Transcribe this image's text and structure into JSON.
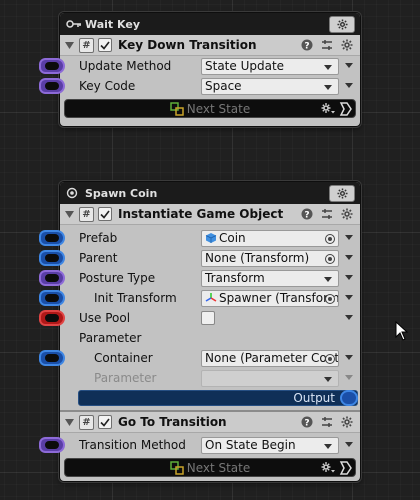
{
  "node1": {
    "title": "Wait Key",
    "component": {
      "title": "Key Down Transition",
      "rows": [
        {
          "label": "Update Method",
          "value": "State Update"
        },
        {
          "label": "Key Code",
          "value": "Space"
        }
      ],
      "state_bar": "Next State"
    }
  },
  "node2": {
    "title": "Spawn Coin",
    "component1": {
      "title": "Instantiate Game Object",
      "rows": {
        "prefab": {
          "label": "Prefab",
          "value": "Coin"
        },
        "parent": {
          "label": "Parent",
          "value": "None (Transform)"
        },
        "posture_type": {
          "label": "Posture Type",
          "value": "Transform"
        },
        "init_transform": {
          "label": "Init Transform",
          "value": "Spawner (Transform)"
        },
        "use_pool": {
          "label": "Use Pool",
          "checked": false
        },
        "parameter_header": {
          "label": "Parameter"
        },
        "container": {
          "label": "Container",
          "value": "None (Parameter Container)"
        },
        "parameter": {
          "label": "Parameter",
          "value": ""
        }
      },
      "output_label": "Output"
    },
    "component2": {
      "title": "Go To Transition",
      "rows": [
        {
          "label": "Transition Method",
          "value": "On State Begin"
        }
      ],
      "state_bar": "Next State"
    }
  },
  "colors": {
    "port_purple": "#5a3ea6",
    "port_blue": "#1a4fa8",
    "port_red": "#b01818",
    "output_bar": "#0f2f57",
    "node_body": "#c2c2c2",
    "header": "#1b1b1b"
  }
}
